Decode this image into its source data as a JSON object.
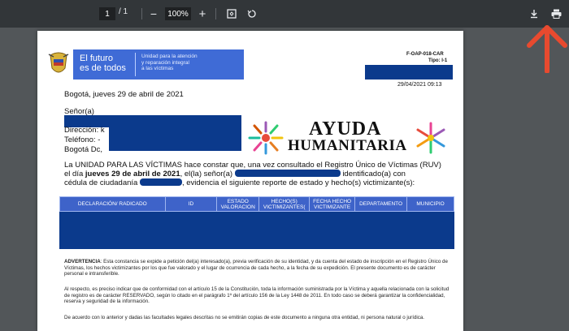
{
  "toolbar": {
    "page_current": "1",
    "page_separator": "/ 1",
    "zoom": "100%"
  },
  "header": {
    "gov_line1": "El futuro",
    "gov_line2": "es de todos",
    "unit_line1": "Unidad para la atención",
    "unit_line2": "y reparación integral",
    "unit_line3": "a las víctimas",
    "form_code": "F-OAP-018-CAR",
    "form_type": "Tipo: I-1",
    "form_date": "29/04/2021 09:13"
  },
  "letter": {
    "date_line": "Bogotá, jueves 29 de abril de 2021",
    "salutation": "Señor(a)",
    "direccion": "Dirección: k",
    "telefono": "Teléfono: -",
    "ciudad": "Bogotá Dc,",
    "p1_a": "La UNIDAD PARA LAS VÍCTIMAS hace constar que, una vez consultado el Registro Único de Víctimas (RUV)",
    "p1_b1": "el día",
    "p1_b2": "jueves 29 de abril de 2021",
    "p1_b3": ", el(la) señor(a)",
    "p1_b4": "identificado(a) con",
    "p1_c1": "cédula de ciudadanía",
    "p1_c2": ", evidencia el siguiente reporte de estado y hecho(s) victimizante(s):"
  },
  "logo": {
    "line1": "AYUDA",
    "line2": "HUMANITARIA"
  },
  "table": {
    "headers": [
      "DECLARACIÓN/ RADICADO",
      "ID",
      "ESTADO VALORACION",
      "HECHO(S) VICTIMIZANTES(",
      "FECHA HECHO VICTIMIZANTE",
      "DEPARTAMENTO",
      "MUNICIPIO"
    ]
  },
  "notes": {
    "advertencia_label": "ADVERTENCIA",
    "advertencia_text": ": Esta constancia se expide a petición del(a) interesado(a), previa verificación de su identidad, y da cuenta del estado de inscripción en el Registro Único de Víctimas, los hechos victimizantes por los que fue valorado y el lugar de ocurrencia de cada hecho, a la fecha de su expedición. El presente documento es de carácter personal e intransferible.",
    "respecto": "Al respecto, es preciso indicar que de conformidad con el artículo 15 de la Constitución, toda la información suministrada por la Víctima y aquella relacionada con la solicitud de registro es de carácter RESERVADO, según lo citado en el parágrafo 1º del artículo 156 de la Ley 1448 de 2011. En todo caso se deberá garantizar la confidencialidad, reserva y seguridad de la información.",
    "acuerdo": "De acuerdo con lo anterior y dadas las facultades legales descritas no se emitirán copias de este documento a ninguna otra entidad, ni persona natural o jurídica."
  },
  "colors": {
    "toolbar": "#323639",
    "viewer_bg": "#525659",
    "redaction": "#0b3a8c",
    "table_header": "#3e63c9",
    "arrow": "#e84a2f"
  }
}
